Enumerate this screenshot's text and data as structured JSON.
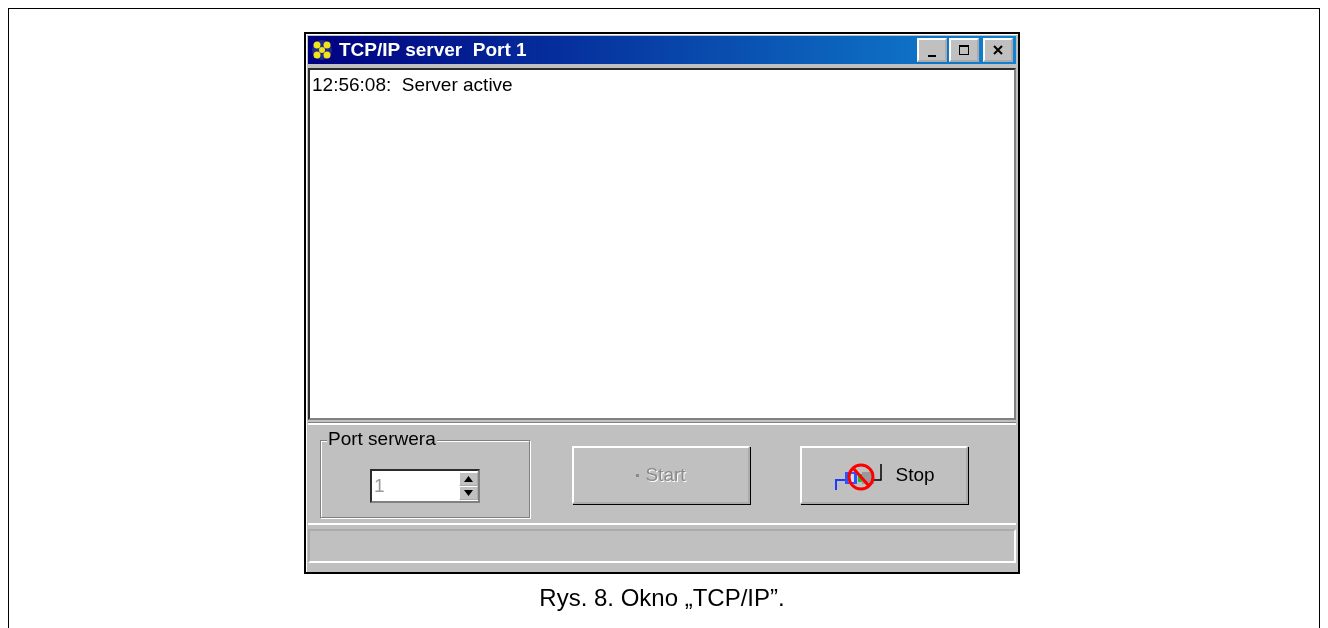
{
  "window": {
    "title": "TCP/IP server  Port 1"
  },
  "log": [
    "12:56:08:  Server active"
  ],
  "port_group": {
    "label": "Port serwera",
    "value": "1",
    "disabled": true
  },
  "buttons": [
    {
      "kind": "start",
      "label": "Start",
      "disabled": true
    },
    {
      "kind": "stop",
      "label": "Stop",
      "disabled": false
    }
  ],
  "caption": "Rys. 8. Okno „TCP/IP”."
}
